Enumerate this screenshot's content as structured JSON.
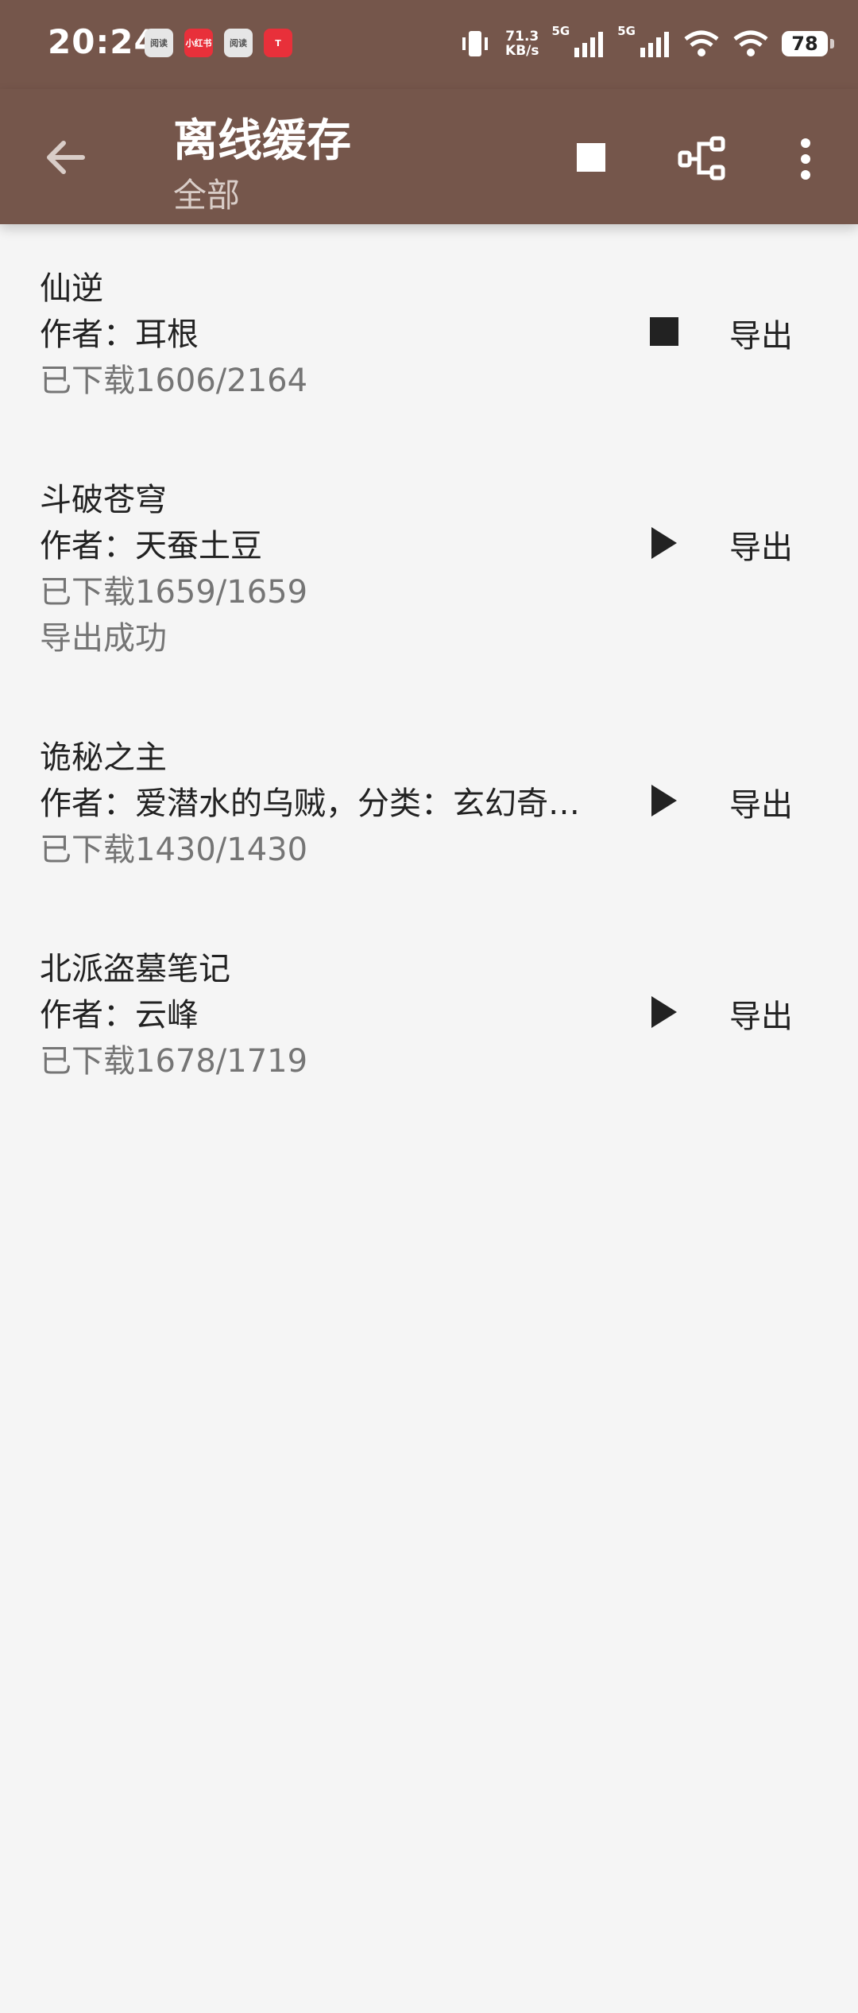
{
  "status_bar": {
    "time": "20:24",
    "notification_icons": [
      {
        "icon": "reader-app-icon",
        "text": "阅读"
      },
      {
        "icon": "xiaohongshu-icon",
        "text": "小红书"
      },
      {
        "icon": "reader-app-icon",
        "text": "阅读"
      },
      {
        "icon": "tesla-icon",
        "text": "T"
      }
    ],
    "net_speed_value": "71.3",
    "net_speed_unit": "KB/s",
    "signal_label_1": "5G",
    "signal_label_2": "5G",
    "battery": "78"
  },
  "toolbar": {
    "title": "离线缓存",
    "subtitle": "全部",
    "background_color": "#75564b",
    "actions": [
      "back-arrow-icon",
      "stop-icon",
      "tree-icon",
      "more-vert-icon"
    ]
  },
  "books": [
    {
      "name": "仙逆",
      "author": "作者：耳根",
      "progress": "已下载1606/2164",
      "status": "",
      "control": "stop",
      "export_label": "导出"
    },
    {
      "name": "斗破苍穹",
      "author": "作者：天蚕土豆",
      "progress": "已下载1659/1659",
      "status": "导出成功",
      "control": "play",
      "export_label": "导出"
    },
    {
      "name": "诡秘之主",
      "author": "作者：爱潜水的乌贼，分类：玄幻奇…",
      "progress": "已下载1430/1430",
      "status": "",
      "control": "play",
      "export_label": "导出"
    },
    {
      "name": "北派盗墓笔记",
      "author": "作者：云峰",
      "progress": "已下载1678/1719",
      "status": "",
      "control": "play",
      "export_label": "导出"
    }
  ]
}
